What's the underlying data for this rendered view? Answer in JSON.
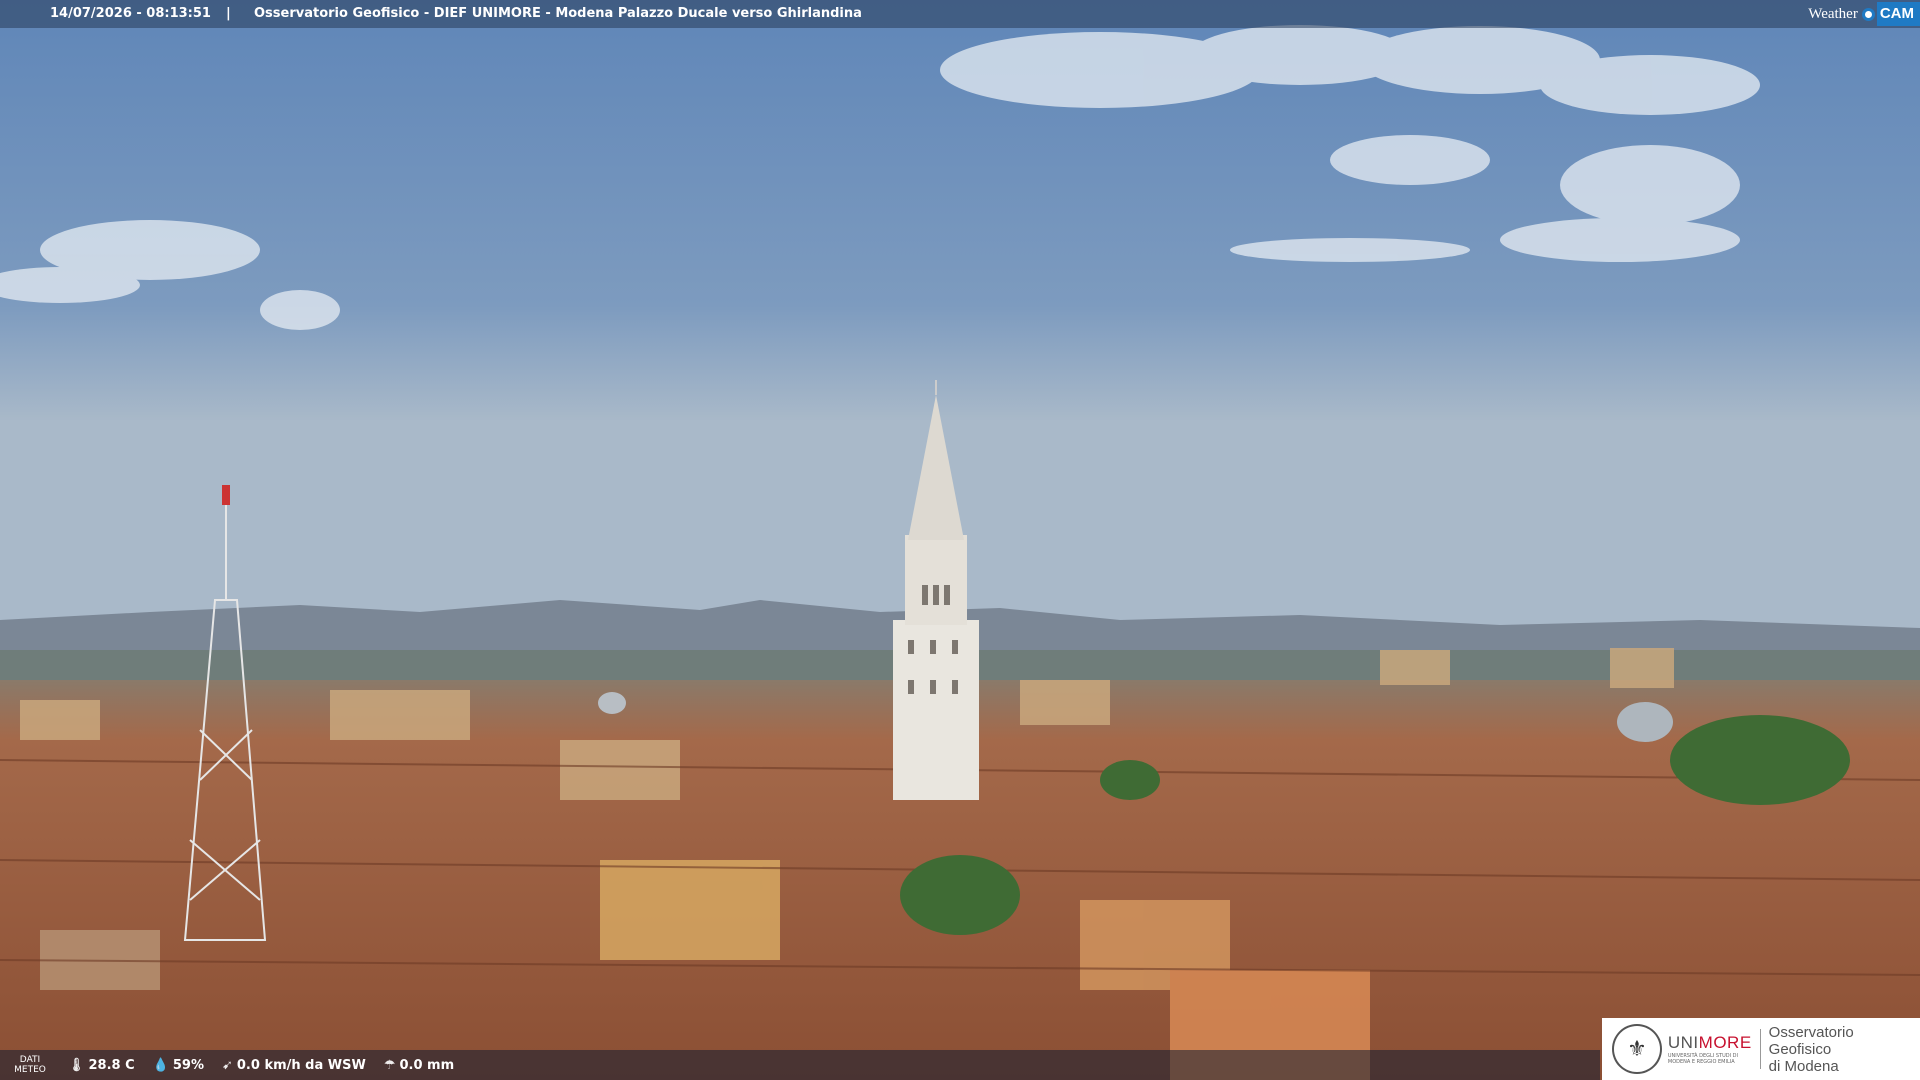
{
  "header": {
    "timestamp": "14/07/2026 - 08:13:51",
    "separator": "|",
    "camera_title": "Osservatorio Geofisico - DIEF UNIMORE - Modena Palazzo Ducale verso Ghirlandina",
    "logo_weather": "Weather",
    "logo_cam": "CAM"
  },
  "weather": {
    "label_line1": "DATI",
    "label_line2": "METEO",
    "temperature": "28.8 C",
    "humidity": "59%",
    "wind": "0.0 km/h da WSW",
    "rain": "0.0 mm",
    "icons": [
      "thermometer-icon",
      "humidity-icon",
      "wind-icon",
      "rain-icon"
    ]
  },
  "branding": {
    "unimore_prefix": "UNI",
    "unimore_suffix": "MORE",
    "unimore_sub1": "UNIVERSITÀ DEGLI STUDI DI",
    "unimore_sub2": "MODENA E REGGIO EMILIA",
    "osservatorio_line1": "Osservatorio Geofisico",
    "osservatorio_line2": "di Modena"
  },
  "colors": {
    "unimore_red": "#c7112f",
    "weathercam_blue": "#1f7ac4"
  }
}
